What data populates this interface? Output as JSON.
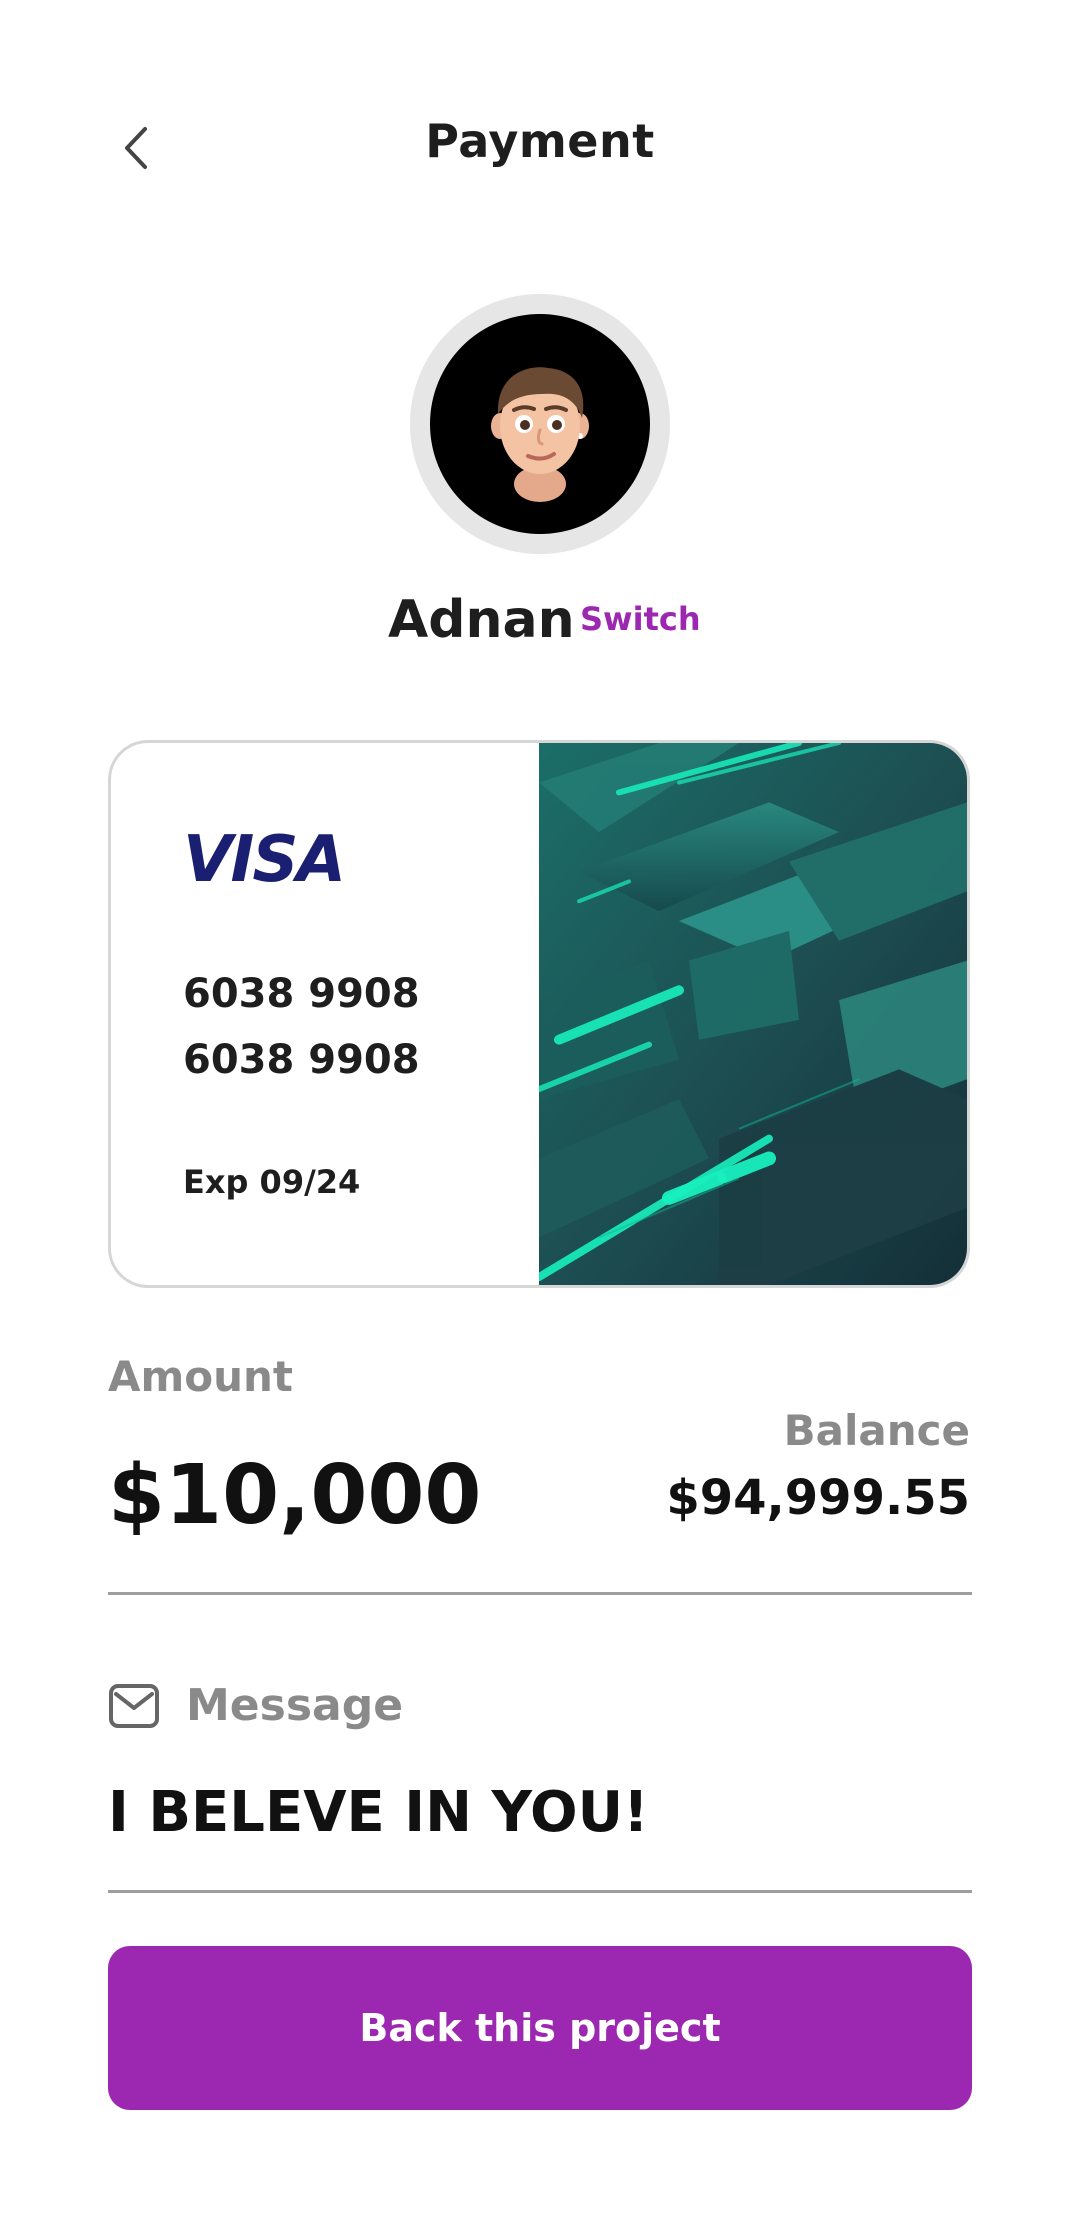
{
  "header": {
    "title": "Payment",
    "back_icon": "chevron-left-icon"
  },
  "user": {
    "name": "Adnan",
    "switch_label": "Switch",
    "avatar": "memoji-avatar"
  },
  "card": {
    "brand": "VISA",
    "number": "6038 9908\n6038 9908",
    "expiry": "Exp 09/24",
    "art": "teal-3d-blocks-art"
  },
  "amount": {
    "label": "Amount",
    "value": "$10,000"
  },
  "balance": {
    "label": "Balance",
    "value": "$94,999.55"
  },
  "message": {
    "label": "Message",
    "value": "I BELEVE IN YOU!",
    "icon": "mail-icon"
  },
  "cta": {
    "label": "Back this project"
  },
  "colors": {
    "accent": "#9c27b0",
    "visa_blue": "#1a1f71",
    "text": "#1e1e1e",
    "muted": "#8a8a8a",
    "divider": "#9e9e9e"
  }
}
